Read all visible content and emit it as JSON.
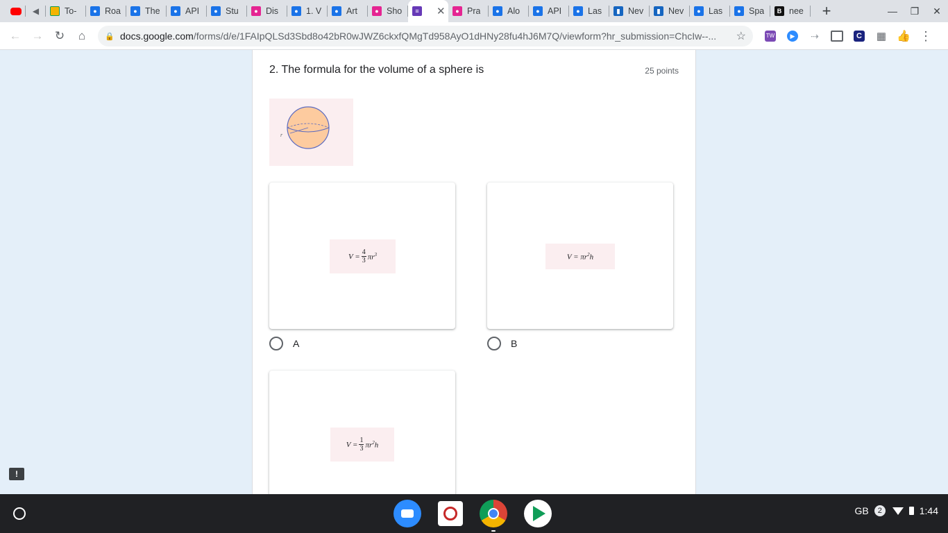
{
  "browser": {
    "tabs": [
      {
        "title": "",
        "icon": "youtube-icon"
      },
      {
        "title": "",
        "icon": "speaker-muted-icon"
      },
      {
        "title": "To-",
        "icon": "classroom-icon"
      },
      {
        "title": "Roa",
        "icon": "user-badge-icon"
      },
      {
        "title": "The",
        "icon": "user-badge-icon"
      },
      {
        "title": "API",
        "icon": "user-badge-icon"
      },
      {
        "title": "Stu",
        "icon": "user-badge-icon"
      },
      {
        "title": "Dis",
        "icon": "pink-badge-icon"
      },
      {
        "title": "1. V",
        "icon": "user-badge-icon"
      },
      {
        "title": "Art",
        "icon": "user-badge-icon"
      },
      {
        "title": "Sho",
        "icon": "pink-badge-icon"
      },
      {
        "title": "",
        "icon": "google-forms-icon",
        "active": true
      },
      {
        "title": "Pra",
        "icon": "pink-badge-icon"
      },
      {
        "title": "Alo",
        "icon": "user-badge-icon"
      },
      {
        "title": "API",
        "icon": "user-badge-icon"
      },
      {
        "title": "Las",
        "icon": "user-badge-icon"
      },
      {
        "title": "Nev",
        "icon": "trello-icon"
      },
      {
        "title": "Nev",
        "icon": "trello-icon"
      },
      {
        "title": "Las",
        "icon": "user-badge-icon"
      },
      {
        "title": "Spa",
        "icon": "user-badge-icon"
      },
      {
        "title": "nee",
        "icon": "brainly-icon"
      }
    ],
    "new_tab": "+",
    "close_glyph": "✕",
    "url_host": "docs.google.com",
    "url_path": "/forms/d/e/1FAIpQLSd3Sbd8o42bR0wJWZ6ckxfQMgTd958AyO1dHNy28fu4hJ6M7Q/viewform?hr_submission=ChcIw--..."
  },
  "form": {
    "question_title": "2. The formula for the volume of a sphere is",
    "points": "25 points",
    "options": [
      {
        "label": "A",
        "formula": "V = 4/3 πr³"
      },
      {
        "label": "B",
        "formula": "V = πr²h"
      },
      {
        "label": "",
        "formula": "V = 1/3 πr²h"
      }
    ],
    "sphere_radius_label": "r"
  },
  "shelf": {
    "keyboard_layout": "GB",
    "notification_count": "2",
    "time": "1:44"
  },
  "colors": {
    "page_bg": "#e4eff9",
    "sphere_fill": "#fdcb9f",
    "sphere_stroke": "#5c6bc0"
  }
}
